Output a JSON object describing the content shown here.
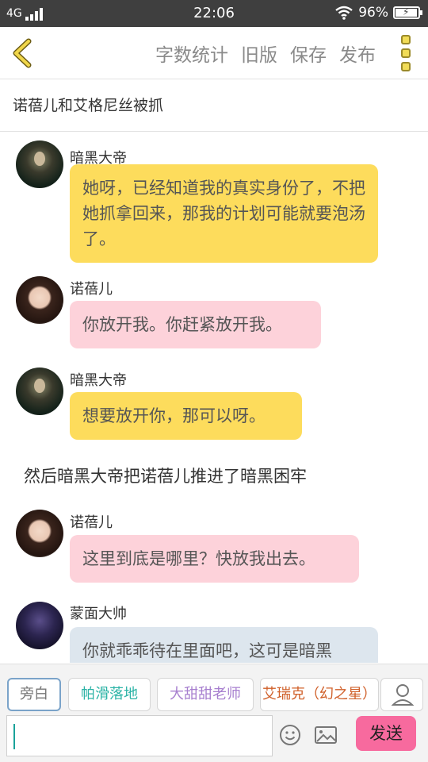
{
  "status_bar": {
    "network": "4G",
    "time": "22:06",
    "battery_percent": "96%",
    "battery_level": 0.96
  },
  "toolbar": {
    "actions": [
      "字数统计",
      "旧版",
      "保存",
      "发布"
    ]
  },
  "story_title": "诺蓓儿和艾格尼丝被抓",
  "messages": [
    {
      "type": "chat",
      "sender": "暗黑大帝",
      "avatar": "dark-emperor-avatar",
      "bubble_color": "#fddc5c",
      "text": "她呀，已经知道我的真实身份了，不把她抓拿回来，那我的计划可能就要泡汤了。"
    },
    {
      "type": "chat",
      "sender": "诺蓓儿",
      "avatar": "nuobeier-avatar",
      "bubble_color": "#fdd2da",
      "text": "你放开我。你赶紧放开我。"
    },
    {
      "type": "chat",
      "sender": "暗黑大帝",
      "avatar": "dark-emperor-avatar",
      "bubble_color": "#fddc5c",
      "text": "想要放开你，那可以呀。"
    },
    {
      "type": "narration",
      "text": "然后暗黑大帝把诺蓓儿推进了暗黑困牢"
    },
    {
      "type": "chat",
      "sender": "诺蓓儿",
      "avatar": "nuobeier-avatar",
      "bubble_color": "#fdd2da",
      "text": "这里到底是哪里？快放我出去。"
    },
    {
      "type": "chat",
      "sender": "蒙面大帅",
      "avatar": "masked-marshal-avatar",
      "bubble_color": "#dde6ee",
      "text": "你就乖乖待在里面吧，这可是暗黑"
    }
  ],
  "characters": [
    {
      "label": "旁白",
      "color": "#777777",
      "selected": true
    },
    {
      "label": "帕滑落地",
      "color": "#2bb3a6",
      "selected": false
    },
    {
      "label": "大甜甜老师",
      "color": "#a77fcf",
      "selected": false
    },
    {
      "label": "艾瑞克（幻之星）",
      "color": "#d0602a",
      "selected": false
    }
  ],
  "input": {
    "value": "",
    "send_label": "发送"
  },
  "icons": {
    "back": "chevron-left-icon",
    "more": "more-vertical-icon",
    "profile": "user-icon",
    "emoji": "smiley-icon",
    "image": "image-icon"
  }
}
